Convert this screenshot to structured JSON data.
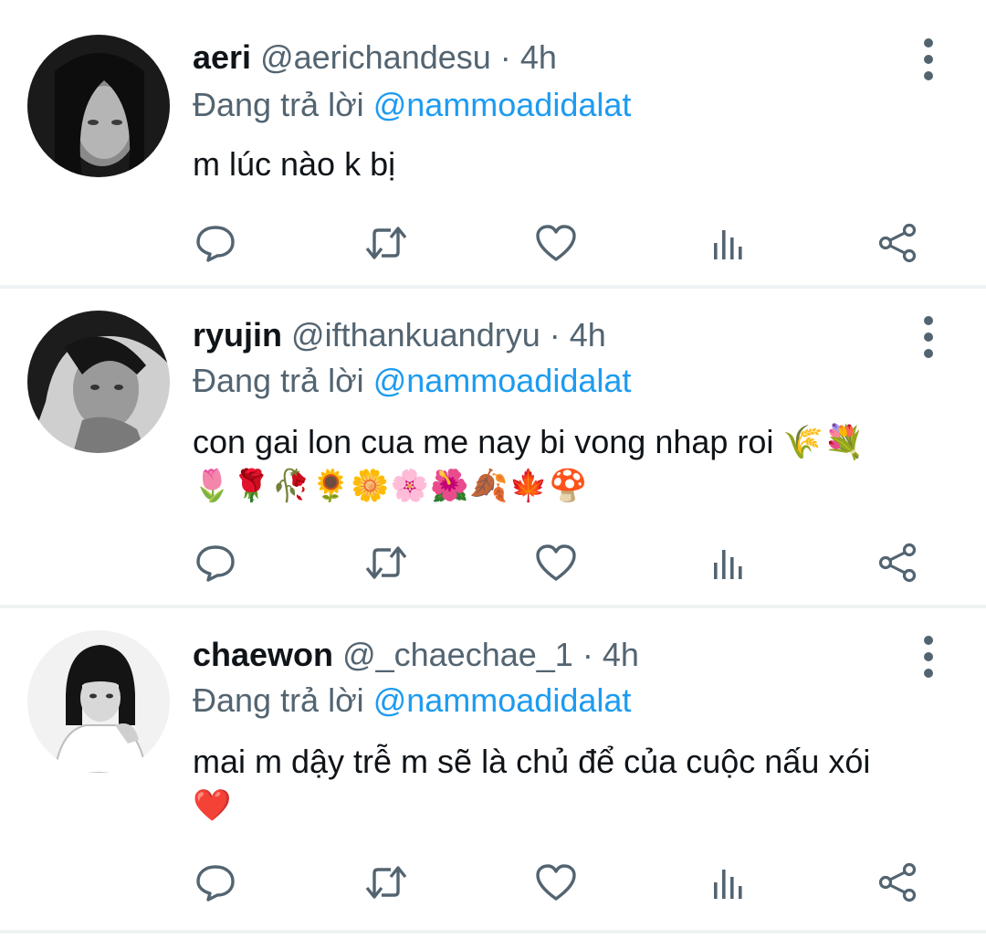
{
  "tweets": [
    {
      "name": "aeri",
      "handle": "@aerichandesu",
      "separator": "·",
      "time": "4h",
      "reply_prefix": "Đang trả lời",
      "reply_to": "@nammoadidalat",
      "text": "m lúc nào k bị",
      "text_line2": ""
    },
    {
      "name": "ryujin",
      "handle": "@ifthankuandryu",
      "separator": "·",
      "time": "4h",
      "reply_prefix": "Đang trả lời",
      "reply_to": "@nammoadidalat",
      "text": "con gai lon cua me nay bi vong nhap roi 🌾💐",
      "text_line2": "🌷🌹🥀🌻🌼🌸🌺🍂🍁🍄"
    },
    {
      "name": "chaewon",
      "handle": "@_chaechae_1",
      "separator": "·",
      "time": "4h",
      "reply_prefix": "Đang trả lời",
      "reply_to": "@nammoadidalat",
      "text": "mai m dậy trễ m sẽ là chủ để của cuộc nấu xói",
      "text_line2": "❤️"
    }
  ],
  "icons": {
    "reply": "reply-icon",
    "retweet": "retweet-icon",
    "like": "like-icon",
    "analytics": "analytics-icon",
    "share": "share-icon",
    "more": "more-vertical-icon"
  },
  "colors": {
    "text": "#0f1419",
    "secondary": "#536471",
    "mention": "#1d9bf0",
    "divider": "#eff3f4"
  }
}
